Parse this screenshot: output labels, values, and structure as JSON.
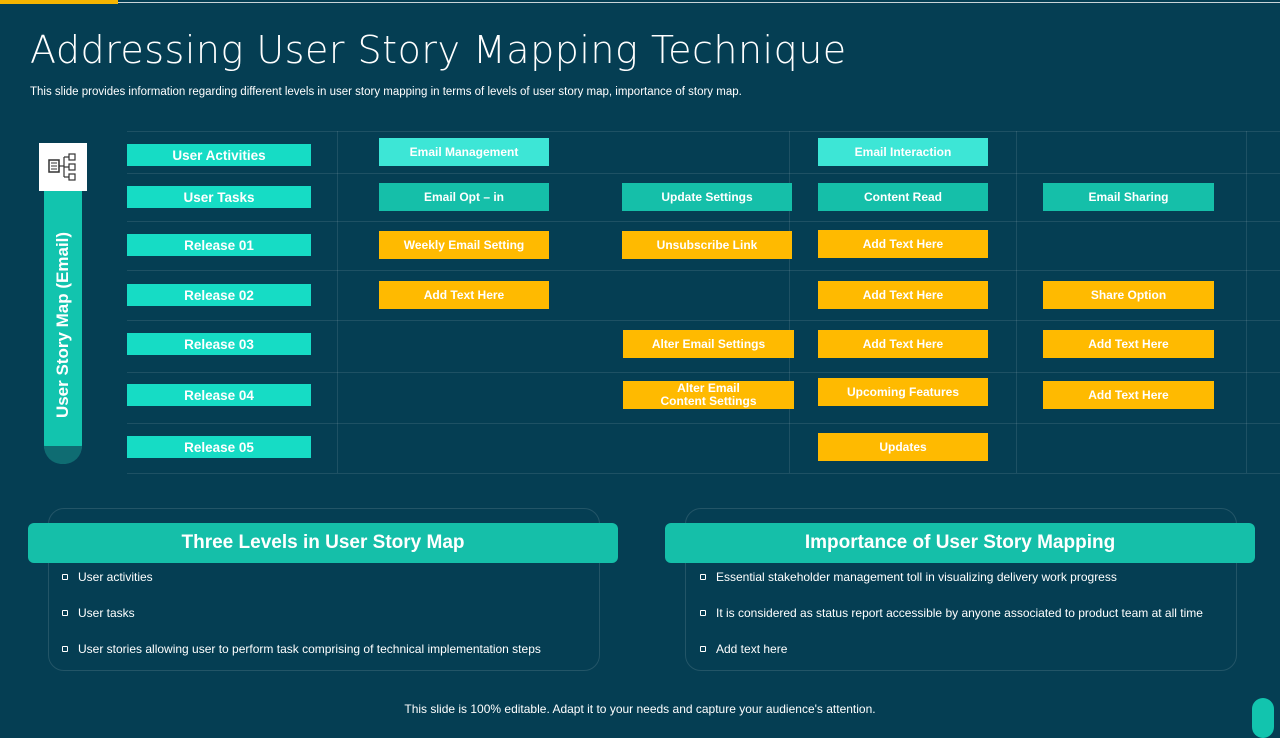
{
  "title": "Addressing User Story Mapping Technique",
  "subtitle": "This slide provides information regarding different levels in user story mapping in terms of levels of user story map, importance of story map.",
  "side_label": "User Story Map (Email)",
  "side_icon": "story-map-icon",
  "rows": [
    "User Activities",
    "User Tasks",
    "Release 01",
    "Release 02",
    "Release 03",
    "Release 04",
    "Release 05"
  ],
  "cells": {
    "activity_1": "Email Management",
    "activity_2": "Email Interaction",
    "task_1": "Email Opt – in",
    "task_2": "Update Settings",
    "task_3": "Content Read",
    "task_4": "Email Sharing",
    "r1_1": "Weekly Email Setting",
    "r1_2": "Unsubscribe Link",
    "r1_3": "Add Text Here",
    "r2_1": "Add Text Here",
    "r2_3": "Add Text Here",
    "r2_4": "Share Option",
    "r3_2": "Alter Email Settings",
    "r3_3": "Add Text Here",
    "r3_4": "Add Text Here",
    "r4_2": "Alter Email\nContent Settings",
    "r4_3": "Upcoming Features",
    "r4_4": "Add Text Here",
    "r5_3": "Updates"
  },
  "colors": {
    "background": "#053E53",
    "accent": "#F6B400",
    "teal": "#15BFA9",
    "aqua": "#3DE6D6",
    "gold": "#FFBA00"
  },
  "panels": {
    "left": {
      "header": "Three Levels in User Story Map",
      "items": [
        "User activities",
        "User tasks",
        "User stories allowing user to perform task comprising of technical implementation steps"
      ]
    },
    "right": {
      "header": "Importance of User Story Mapping",
      "items": [
        "Essential stakeholder management toll in visualizing delivery work progress",
        "It is considered as status report accessible by anyone associated to product team at all time",
        "Add text here"
      ]
    }
  },
  "footer": "This slide is 100% editable. Adapt it to your needs and capture your audience's attention."
}
